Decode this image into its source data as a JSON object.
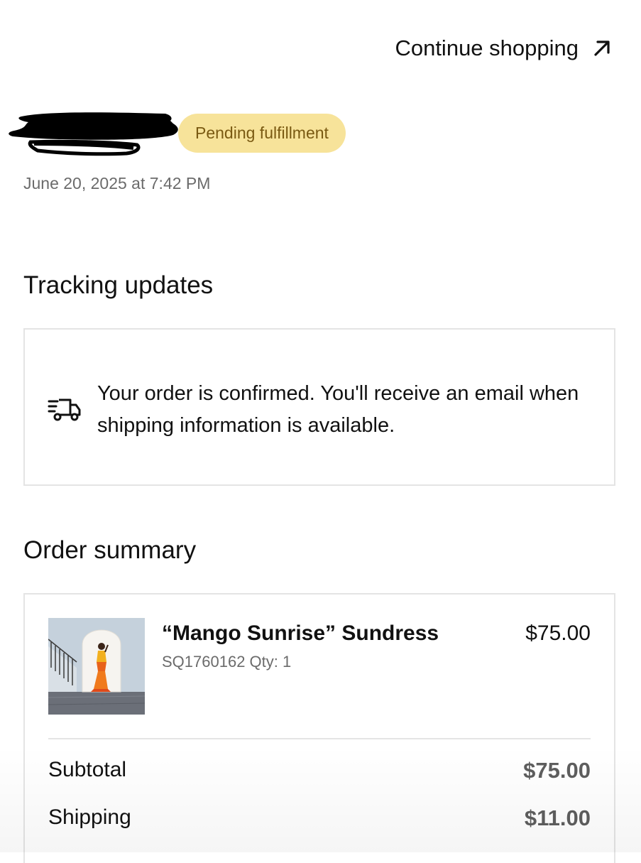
{
  "header": {
    "continue_label": "Continue shopping",
    "continue_icon": "arrow-up-right-icon"
  },
  "order": {
    "status_badge": "Pending fulfillment",
    "status_color": "#f7e39a",
    "date": "June 20, 2025 at 7:42 PM"
  },
  "tracking": {
    "title": "Tracking updates",
    "icon": "delivery-truck-icon",
    "message": "Your order is confirmed. You'll receive an email when shipping information is available."
  },
  "summary": {
    "title": "Order summary",
    "item": {
      "name": "“Mango Sunrise” Sundress",
      "meta": "SQ1760162 Qty: 1",
      "price": "$75.00"
    },
    "rows": [
      {
        "label": "Subtotal",
        "value": "$75.00"
      },
      {
        "label": "Shipping",
        "value": "$11.00"
      }
    ]
  }
}
